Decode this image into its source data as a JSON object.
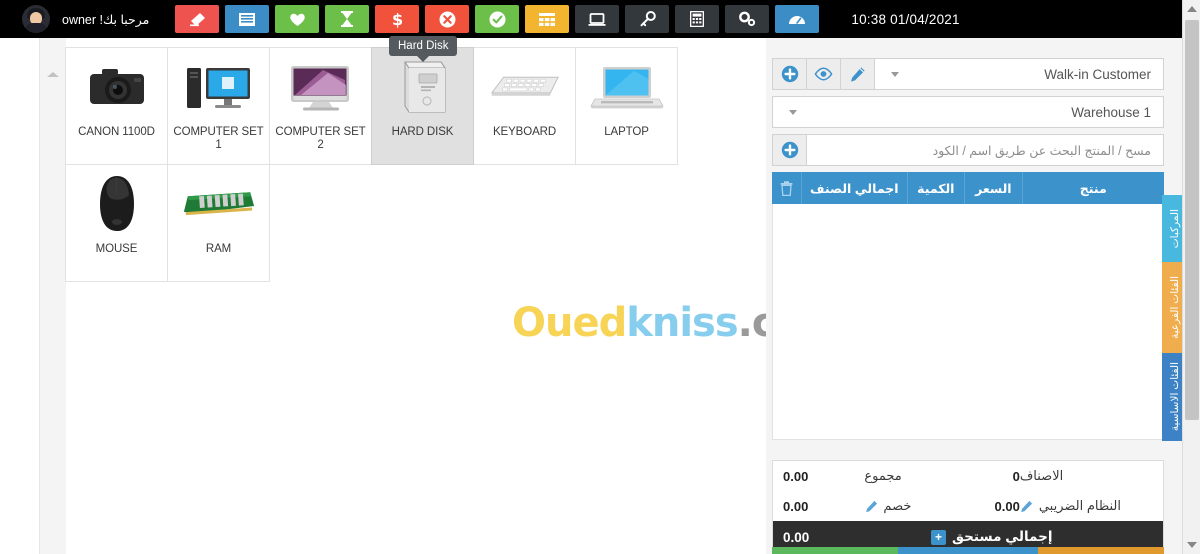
{
  "topbar": {
    "welcome": "مرحبا بك! owner",
    "clock": "10:38 01/04/2021",
    "buttons": [
      {
        "name": "eraser",
        "label": "",
        "color": "#ef5350"
      },
      {
        "name": "list",
        "label": "",
        "color": "#3c8dc5"
      },
      {
        "name": "heart",
        "label": "",
        "color": "#6cc04a"
      },
      {
        "name": "hourglass",
        "label": "",
        "color": "#6cc04a"
      },
      {
        "name": "dollar",
        "label": "",
        "color": "#f0523c"
      },
      {
        "name": "times-circle",
        "label": "",
        "color": "#f0523c"
      },
      {
        "name": "check-circle",
        "label": "",
        "color": "#6cc04a"
      },
      {
        "name": "grid",
        "label": "",
        "color": "#f3b530"
      },
      {
        "name": "desktop",
        "label": "",
        "color": "#33383d"
      },
      {
        "name": "key",
        "label": "",
        "color": "#33383d"
      },
      {
        "name": "calculator",
        "label": "",
        "color": "#33383d"
      },
      {
        "name": "cogs",
        "label": "",
        "color": "#33383d"
      },
      {
        "name": "dashboard",
        "label": "",
        "color": "#3c8dc5"
      }
    ]
  },
  "tooltip": {
    "text": "Hard Disk"
  },
  "products": [
    {
      "name": "CANON 1100D",
      "icon": "camera",
      "selected": false
    },
    {
      "name": "COMPUTER SET 1",
      "icon": "desktop-pc",
      "selected": false
    },
    {
      "name": "COMPUTER SET 2",
      "icon": "imac",
      "selected": false
    },
    {
      "name": "HARD DISK",
      "icon": "harddisk",
      "selected": true
    },
    {
      "name": "KEYBOARD",
      "icon": "keyboard",
      "selected": false
    },
    {
      "name": "LAPTOP",
      "icon": "laptop",
      "selected": false
    },
    {
      "name": "MOUSE",
      "icon": "mouse",
      "selected": false
    },
    {
      "name": "RAM",
      "icon": "ram",
      "selected": false
    }
  ],
  "watermark": {
    "part1": "Oued",
    "part2": "kniss",
    "part3": ".com"
  },
  "order": {
    "customer": "Walk-in Customer",
    "warehouse": "Warehouse 1",
    "search_placeholder": "مسح / المنتج البحث عن طريق اسم / الكود",
    "table_headers": {
      "product": "منتج",
      "price": "السعر",
      "quantity": "الكمية",
      "subtotal": "اجمالي الصنف",
      "delete": ""
    }
  },
  "side_tabs": [
    {
      "label": "المركبات",
      "color": "#49b8df"
    },
    {
      "label": "الفئات الفرعية",
      "color": "#f0ad4e"
    },
    {
      "label": "الفئات الاساسية",
      "color": "#3c82c4"
    }
  ],
  "totals": {
    "items_label": "الاصناف",
    "items_value": "0",
    "sum_label": "مجموع",
    "sum_value": "0.00",
    "tax_label": "النظام الضريبي",
    "tax_value": "0.00",
    "discount_label": "خصم",
    "discount_value": "0.00",
    "grand_label": "إجمالي مستحق",
    "grand_value": "0.00"
  }
}
